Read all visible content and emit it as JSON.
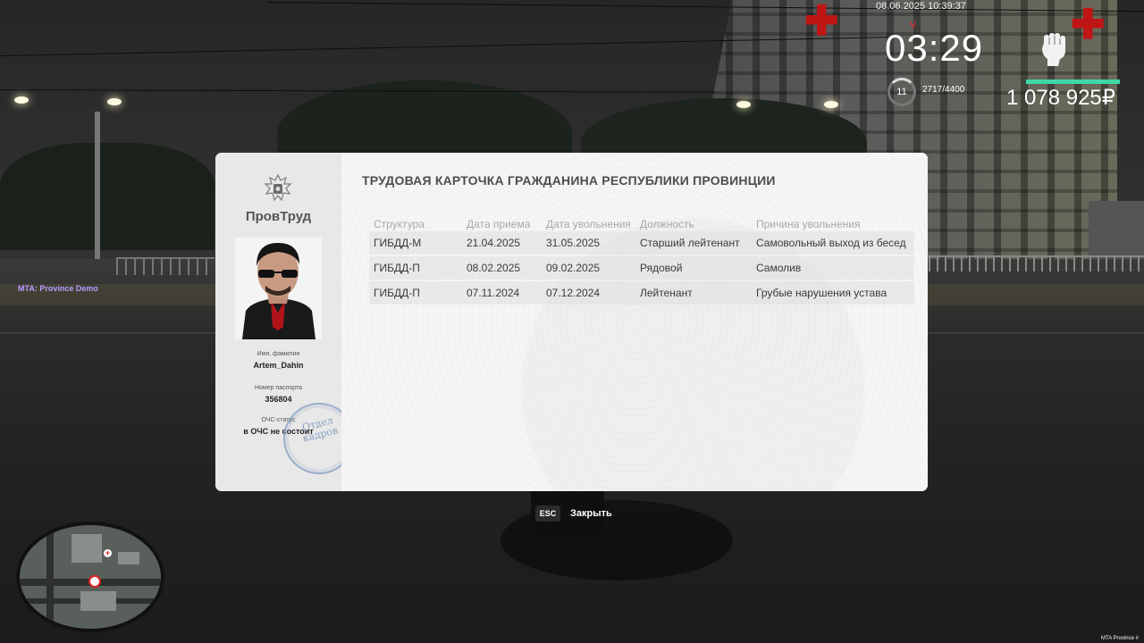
{
  "hud": {
    "datetime": "08.06.2025 10:39:37",
    "time": "03:29",
    "level": "11",
    "xp": "2717/4400",
    "money": "1 078 925₽",
    "server_label": "MTA: Province Demo",
    "corner_label": "MTA Province #",
    "icons": [
      "fork-icon",
      "fist-icon"
    ]
  },
  "card": {
    "brand": "ПровТруд",
    "title": "ТРУДОВАЯ КАРТОЧКА ГРАЖДАНИНА РЕСПУБЛИКИ ПРОВИНЦИИ",
    "name_label": "Имя, фамилия",
    "name_value": "Artem_Dahin",
    "passport_label": "Номер паспорта",
    "passport_value": "356804",
    "status_label": "ОЧС-статус",
    "status_value": "в ОЧС не состоит",
    "stamp_line1": "Отдел",
    "stamp_line2": "кадров",
    "columns": [
      "Структура",
      "Дата приема",
      "Дата увольнения",
      "Должность",
      "Причина увольнения"
    ],
    "rows": [
      {
        "structure": "ГИБДД-М",
        "hired": "21.04.2025",
        "fired": "31.05.2025",
        "position": "Старший лейтенант",
        "reason": "Самовольный выход из бесед"
      },
      {
        "structure": "ГИБДД-П",
        "hired": "08.02.2025",
        "fired": "09.02.2025",
        "position": "Рядовой",
        "reason": "Самолив"
      },
      {
        "structure": "ГИБДД-П",
        "hired": "07.11.2024",
        "fired": "07.12.2024",
        "position": "Лейтенант",
        "reason": "Грубые нарушения устава"
      }
    ]
  },
  "close_hint": {
    "key": "ESC",
    "label": "Закрыть"
  },
  "colors": {
    "health_bar": "#3fd6a8",
    "stamp": "#6e8cb9",
    "hospital_marker": "#d22222"
  }
}
